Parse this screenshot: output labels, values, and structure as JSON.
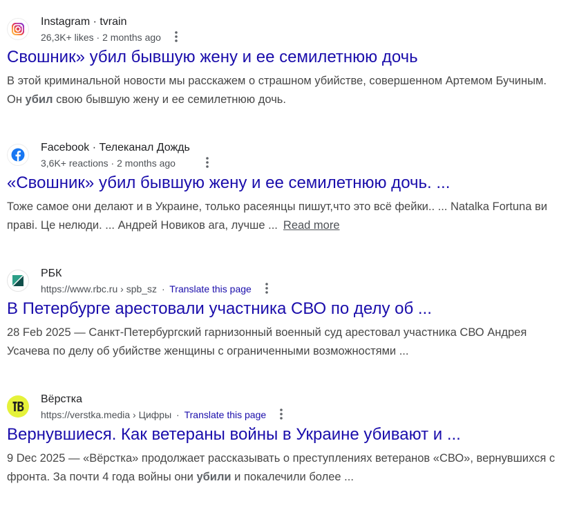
{
  "results": [
    {
      "site_name": "Instagram · tvrain",
      "meta": "26,3K+ likes · 2 months ago",
      "icon": "instagram-icon",
      "title": "Свошник» убил бывшую жену и ее семилетнюю дочь",
      "snippet": {
        "part1": "В этой криминальной новости мы расскажем о страшном убийстве, совершенном Артемом Бучиным. Он ",
        "bold": "убил",
        "part2": " свою бывшую жену и ее семилетнюю дочь."
      }
    },
    {
      "site_name": "Facebook · Телеканал Дождь",
      "meta": "3,6K+ reactions · 2 months ago",
      "icon": "facebook-icon",
      "title": "«Свошник» убил бывшую жену и ее семилетнюю дочь. ...",
      "snippet": {
        "text": "Тоже самое они делают и в Украине, только расеянцы пишут,что это всё фейки.. ... Natalka Fortuna ви праві. Це нелюди. ... Андрей Новиков ага, лучше ...",
        "read_more": "Read more"
      }
    },
    {
      "site_name": "РБК",
      "url": "https://www.rbc.ru › spb_sz",
      "translate": "Translate this page",
      "icon": "rbc-icon",
      "title": "В Петербурге арестовали участника СВО по делу об ...",
      "snippet": {
        "date": "28 Feb 2025",
        "text": " — Санкт-Петербургский гарнизонный военный суд арестовал участника СВО Андрея Усачева по делу об убийстве женщины с ограниченными возможностями ..."
      }
    },
    {
      "site_name": "Вёрстка",
      "url": "https://verstka.media › Цифры",
      "translate": "Translate this page",
      "icon": "verstka-icon",
      "title": "Вернувшиеся. Как ветераны войны в Украине убивают и ...",
      "snippet": {
        "date": "9 Dec 2025",
        "part1": " — «Вёрстка» продолжает рассказывать о преступлениях ветеранов «СВО», вернувшихся с фронта. За почти 4 года войны они ",
        "bold": "убили",
        "part2": " и покалечили более ..."
      }
    }
  ],
  "colors": {
    "title_link": "#1a0dab",
    "snippet_text": "#474747",
    "meta_text": "#4d5156"
  }
}
